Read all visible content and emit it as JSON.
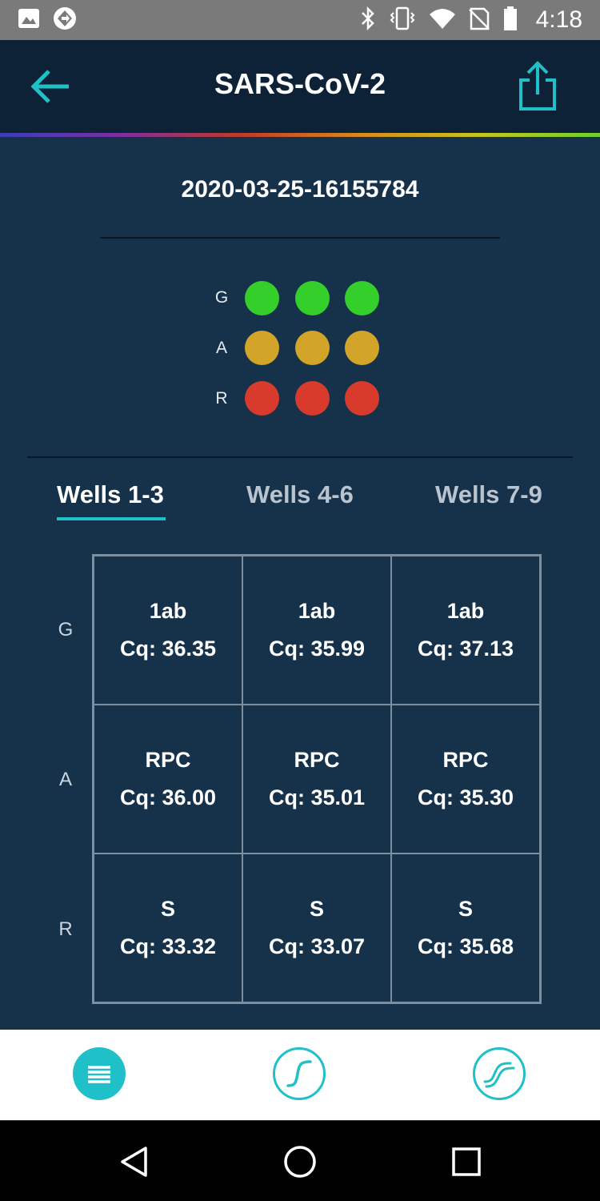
{
  "status_bar": {
    "time": "4:18",
    "left_icons": [
      "image-icon",
      "navigation-icon"
    ],
    "right_icons": [
      "bluetooth-icon",
      "vibrate-icon",
      "wifi-icon",
      "no-sim-icon",
      "battery-icon"
    ]
  },
  "header": {
    "title": "SARS-CoV-2",
    "back_icon": "arrow-left-icon",
    "share_icon": "share-icon"
  },
  "run_id": "2020-03-25-16155784",
  "indicator": {
    "rows": [
      {
        "label": "G",
        "color": "#35cf2c",
        "count": 3
      },
      {
        "label": "A",
        "color": "#d2a42a",
        "count": 3
      },
      {
        "label": "R",
        "color": "#d83b2c",
        "count": 3
      }
    ]
  },
  "tabs": [
    {
      "label": "Wells 1-3",
      "active": true
    },
    {
      "label": "Wells 4-6",
      "active": false
    },
    {
      "label": "Wells 7-9",
      "active": false
    }
  ],
  "grid": {
    "row_labels": [
      "G",
      "A",
      "R"
    ],
    "cells": [
      [
        {
          "target": "1ab",
          "cq": "Cq: 36.35"
        },
        {
          "target": "1ab",
          "cq": "Cq: 35.99"
        },
        {
          "target": "1ab",
          "cq": "Cq: 37.13"
        }
      ],
      [
        {
          "target": "RPC",
          "cq": "Cq: 36.00"
        },
        {
          "target": "RPC",
          "cq": "Cq: 35.01"
        },
        {
          "target": "RPC",
          "cq": "Cq: 35.30"
        }
      ],
      [
        {
          "target": "S",
          "cq": "Cq: 33.32"
        },
        {
          "target": "S",
          "cq": "Cq: 33.07"
        },
        {
          "target": "S",
          "cq": "Cq: 35.68"
        }
      ]
    ]
  },
  "bottom_nav": {
    "items": [
      {
        "icon": "menu-icon",
        "active": true
      },
      {
        "icon": "single-curve-icon",
        "active": false
      },
      {
        "icon": "multi-curve-icon",
        "active": false
      }
    ]
  },
  "system_nav": [
    "back-triangle-icon",
    "home-circle-icon",
    "recents-square-icon"
  ],
  "colors": {
    "accent": "#1fc0c8",
    "background": "#15324a",
    "header": "#0d2236"
  }
}
